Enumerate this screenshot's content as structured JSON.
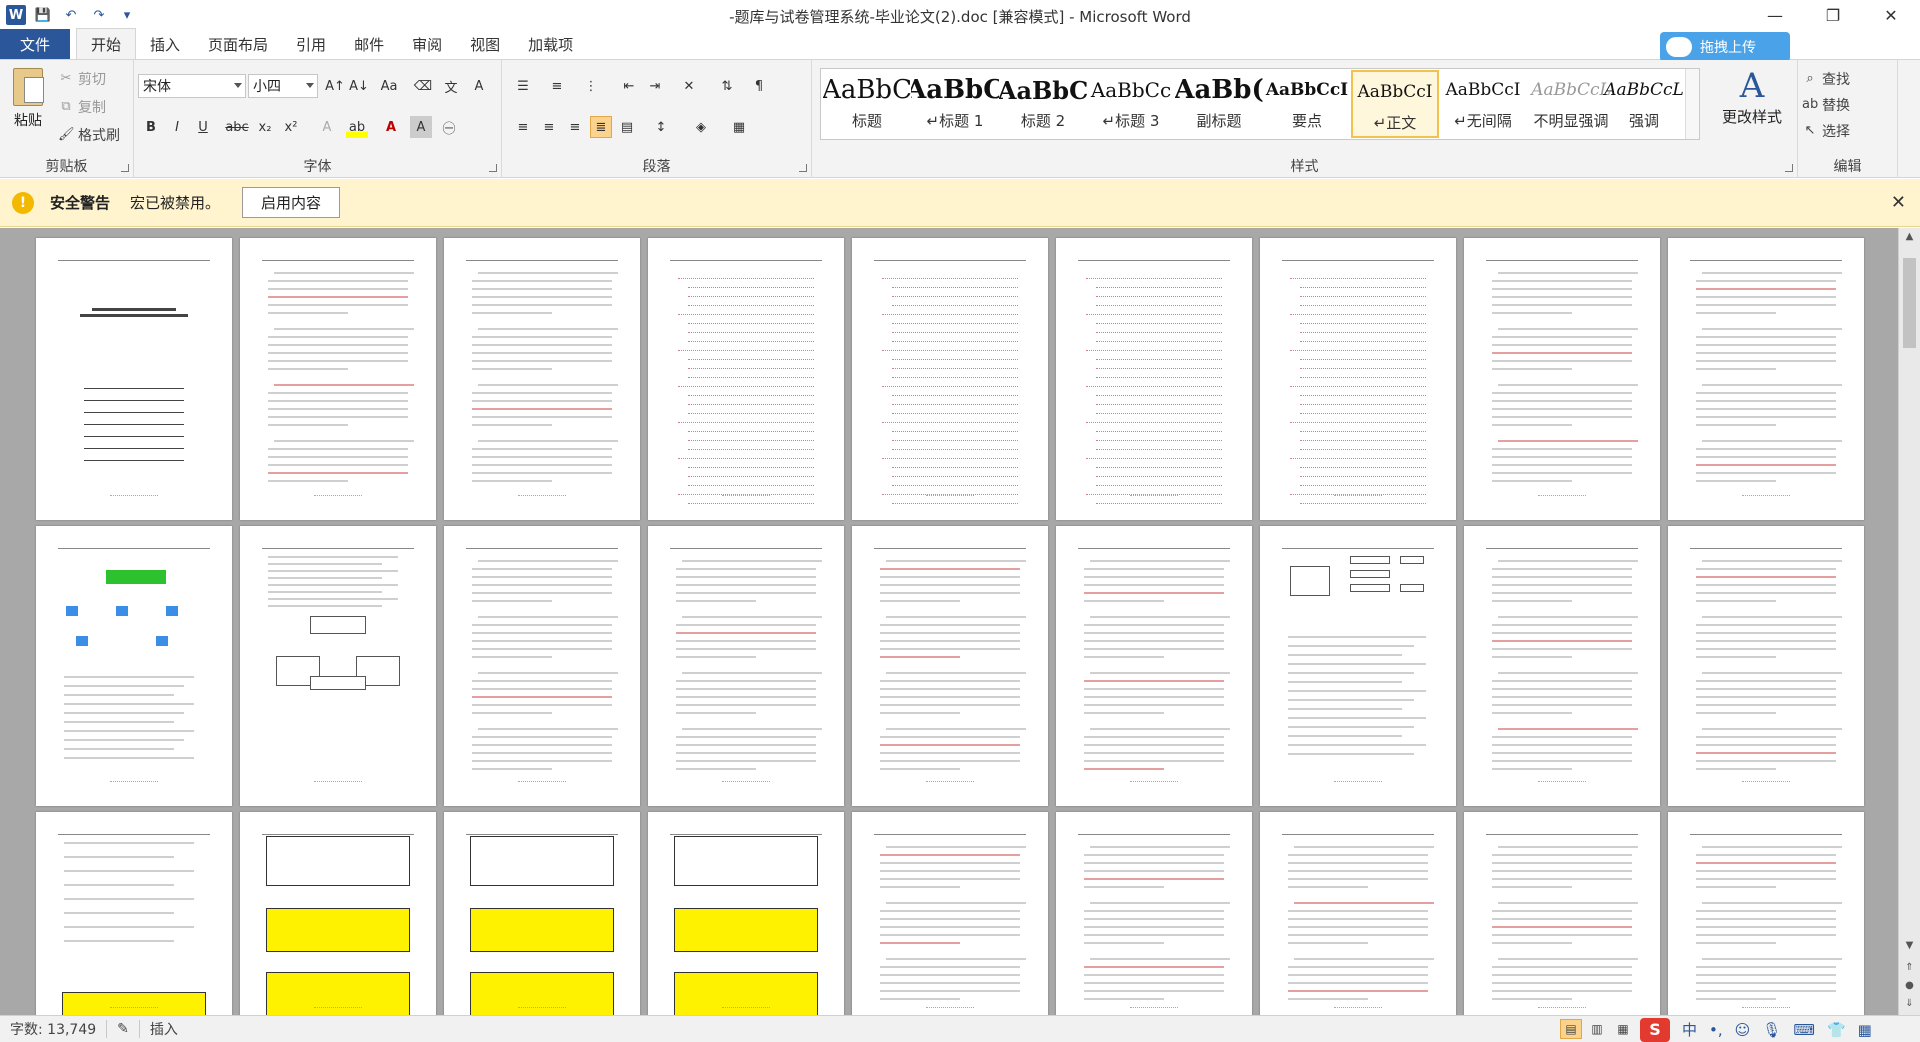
{
  "window": {
    "title": "-题库与试卷管理系统-毕业论文(2).doc [兼容模式] - Microsoft Word",
    "minimize_glyph": "—",
    "maximize_glyph": "❐",
    "close_glyph": "✕"
  },
  "quick_access": {
    "app_icon": "W",
    "save_glyph": "💾",
    "undo_glyph": "↶",
    "redo_glyph": "↷",
    "customize_glyph": "▾"
  },
  "tabs": [
    {
      "label": "文件"
    },
    {
      "label": "开始"
    },
    {
      "label": "插入"
    },
    {
      "label": "页面布局"
    },
    {
      "label": "引用"
    },
    {
      "label": "邮件"
    },
    {
      "label": "审阅"
    },
    {
      "label": "视图"
    },
    {
      "label": "加载项"
    }
  ],
  "upload_button": {
    "label": "拖拽上传"
  },
  "ribbon": {
    "clipboard": {
      "group_label": "剪贴板",
      "paste": "粘贴",
      "cut": "剪切",
      "copy": "复制",
      "format_painter": "格式刷"
    },
    "font": {
      "group_label": "字体",
      "font_name": "宋体",
      "font_size": "小四"
    },
    "paragraph": {
      "group_label": "段落"
    },
    "styles": {
      "group_label": "样式",
      "items": [
        {
          "sample": "AaBbC",
          "name": "标题"
        },
        {
          "sample": "AaBbC",
          "name": "↵标题 1"
        },
        {
          "sample": "AaBbC",
          "name": "标题 2"
        },
        {
          "sample": "AaBbCc",
          "name": "↵标题 3"
        },
        {
          "sample": "AaBb(",
          "name": "副标题"
        },
        {
          "sample": "AaBbCcI",
          "name": "要点"
        },
        {
          "sample": "AaBbCcI",
          "name": "↵正文"
        },
        {
          "sample": "AaBbCcI",
          "name": "↵无间隔"
        },
        {
          "sample": "AaBbCcL",
          "name": "不明显强调"
        },
        {
          "sample": "AaBbCcL",
          "name": "强调"
        }
      ],
      "change_styles": "更改样式"
    },
    "editing": {
      "group_label": "编辑",
      "find": "查找",
      "replace": "替换",
      "select": "选择"
    }
  },
  "security_bar": {
    "title": "安全警告",
    "message": "宏已被禁用。",
    "button": "启用内容",
    "icon_glyph": "!",
    "close_glyph": "✕"
  },
  "status_bar": {
    "word_count": "字数: 13,749",
    "insert_mode": "插入",
    "ime_chinese": "中"
  }
}
